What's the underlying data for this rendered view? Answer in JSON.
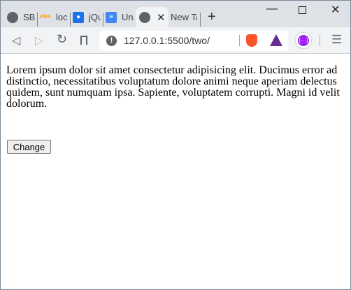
{
  "tabs": [
    {
      "label": "SB",
      "icon": "globe-icon"
    },
    {
      "label": "loc",
      "icon": "phpmyadmin-icon"
    },
    {
      "label": "jQu",
      "icon": "contacts-icon"
    },
    {
      "label": "Un",
      "icon": "docs-icon"
    },
    {
      "label": "",
      "icon": "globe-icon",
      "active": true
    },
    {
      "label": "New Ta",
      "icon": ""
    }
  ],
  "address": {
    "url": "127.0.0.1:5500/two/"
  },
  "page": {
    "paragraph": "Lorem ipsum dolor sit amet consectetur adipisicing elit. Ducimus error ad distinctio, necessitatibus voluptatum dolore animi neque aperiam delectus quidem, sunt numquam ipsa. Sapiente, voluptatem corrupti. Magni id velit dolorum.",
    "button_label": "Change"
  },
  "colors": {
    "brave": "#fb542b",
    "bat": "#662d91",
    "extension": "#a020f0"
  }
}
